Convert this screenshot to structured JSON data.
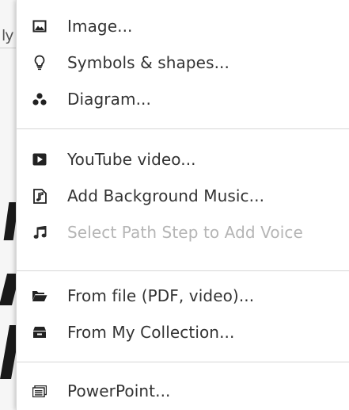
{
  "menu": {
    "items": [
      {
        "label": "Image...",
        "icon": "image-icon",
        "disabled": false
      },
      {
        "label": "Symbols & shapes...",
        "icon": "lightbulb-icon",
        "disabled": false
      },
      {
        "label": "Diagram...",
        "icon": "diagram-icon",
        "disabled": false
      },
      {
        "label": "YouTube video...",
        "icon": "youtube-play-icon",
        "disabled": false
      },
      {
        "label": "Add Background Music...",
        "icon": "music-file-icon",
        "disabled": false
      },
      {
        "label": "Select Path Step to Add Voice",
        "icon": "music-note-icon",
        "disabled": true
      },
      {
        "label": "From file (PDF, video)...",
        "icon": "folder-open-icon",
        "disabled": false
      },
      {
        "label": "From My Collection...",
        "icon": "collection-box-icon",
        "disabled": false
      },
      {
        "label": "PowerPoint...",
        "icon": "powerpoint-icon",
        "disabled": false
      }
    ]
  },
  "colors": {
    "text": "#333333",
    "disabled_text": "#b5b5b5",
    "icon": "#222222",
    "disabled_icon": "#8a8a8a",
    "separator": "#d6d6d6"
  }
}
